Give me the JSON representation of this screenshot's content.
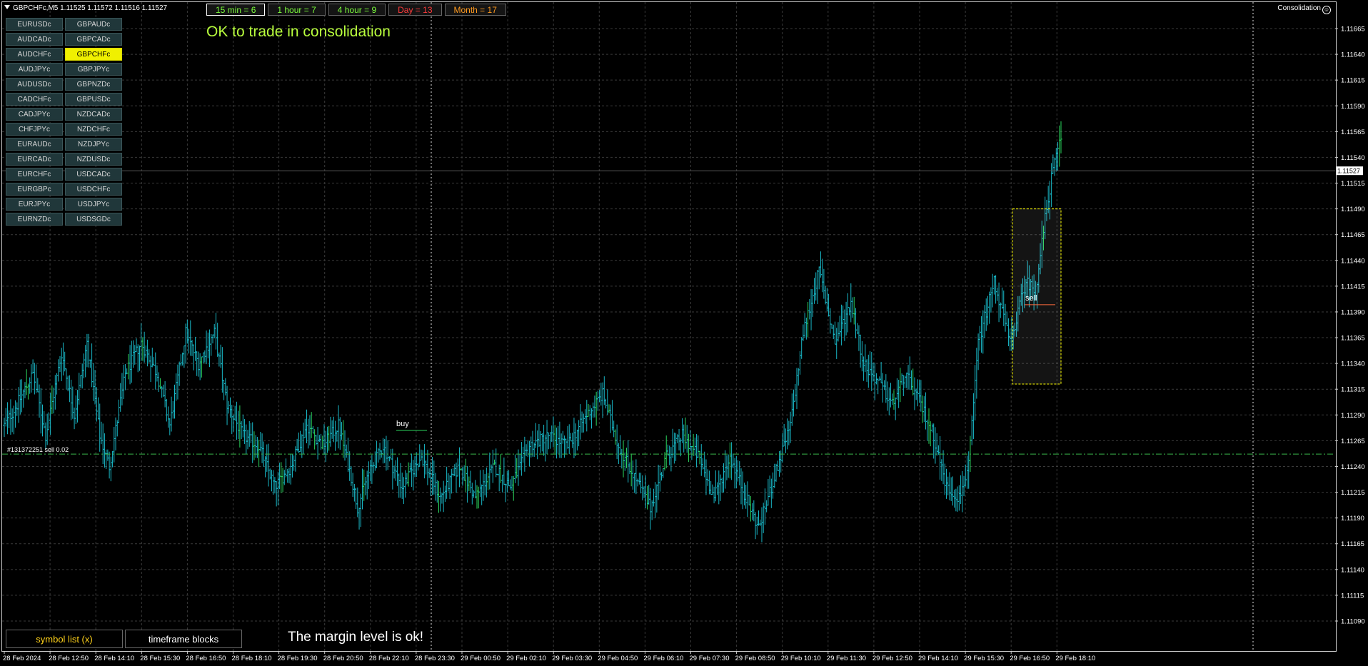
{
  "window": {
    "title": "GBPCHFc,M5  1.11525 1.11572 1.11516 1.11527"
  },
  "indicator": {
    "label": "Consolidation",
    "icon": "smiley-icon"
  },
  "timeframe_blocks": [
    {
      "label": "15 min = 6",
      "color": "#7cff3c",
      "border": "#ffffff"
    },
    {
      "label": "1 hour = 7",
      "color": "#7cff3c",
      "border": "#666666"
    },
    {
      "label": "4 hour = 9",
      "color": "#7cff3c",
      "border": "#666666"
    },
    {
      "label": "Day = 13",
      "color": "#ff3b3b",
      "border": "#666666"
    },
    {
      "label": "Month = 17",
      "color": "#ff9a1f",
      "border": "#666666"
    }
  ],
  "symbols": {
    "col1": [
      "EURUSDc",
      "AUDCADc",
      "AUDCHFc",
      "AUDJPYc",
      "AUDUSDc",
      "CADCHFc",
      "CADJPYc",
      "CHFJPYc",
      "EURAUDc",
      "EURCADc",
      "EURCHFc",
      "EURGBPc",
      "EURJPYc",
      "EURNZDc"
    ],
    "col2": [
      "GBPAUDc",
      "GBPCADc",
      "GBPCHFc",
      "GBPJPYc",
      "GBPNZDc",
      "GBPUSDc",
      "NZDCADc",
      "NZDCHFc",
      "NZDJPYc",
      "NZDUSDc",
      "USDCADc",
      "USDCHFc",
      "USDJPYc",
      "USDSGDc"
    ],
    "active": "GBPCHFc"
  },
  "messages": {
    "consolidation": "OK to trade in consolidation",
    "margin": "The margin level is ok!"
  },
  "buttons": {
    "symbol_list": "symbol list (x)",
    "timeframe_blocks": "timeframe blocks"
  },
  "order_line": {
    "label": "#131372251 sell 0.02",
    "price": 1.11252
  },
  "trade_markers": {
    "buy": "buy",
    "sell": "sell"
  },
  "colors": {
    "candle": "#19b7c6",
    "candle_bull": "#2ad35c",
    "grid": "#3a3a3a",
    "order_line": "#39b54a",
    "consolidation_box": "#ffff00",
    "accent_yellow": "#f0f000"
  },
  "chart_data": {
    "type": "ohlc",
    "symbol": "GBPCHFc",
    "timeframe": "M5",
    "current_price": "1.11527",
    "ylim": [
      1.1107,
      1.1168
    ],
    "y_ticks": [
      "1.11665",
      "1.11640",
      "1.11615",
      "1.11590",
      "1.11565",
      "1.11540",
      "1.11515",
      "1.11490",
      "1.11465",
      "1.11440",
      "1.11415",
      "1.11390",
      "1.11365",
      "1.11340",
      "1.11315",
      "1.11290",
      "1.11265",
      "1.11240",
      "1.11215",
      "1.11190",
      "1.11165",
      "1.11140",
      "1.11115",
      "1.11090"
    ],
    "x_ticks": [
      "28 Feb 2024",
      "28 Feb 12:50",
      "28 Feb 14:10",
      "28 Feb 15:30",
      "28 Feb 16:50",
      "28 Feb 18:10",
      "28 Feb 19:30",
      "28 Feb 20:50",
      "28 Feb 22:10",
      "28 Feb 23:30",
      "29 Feb 00:50",
      "29 Feb 02:10",
      "29 Feb 03:30",
      "29 Feb 04:50",
      "29 Feb 06:10",
      "29 Feb 07:30",
      "29 Feb 08:50",
      "29 Feb 10:10",
      "29 Feb 11:30",
      "29 Feb 12:50",
      "29 Feb 14:10",
      "29 Feb 15:30",
      "29 Feb 16:50",
      "29 Feb 18:10"
    ],
    "consolidation_range": [
      1.1132,
      1.1149
    ],
    "anchors": [
      [
        0,
        1.1128
      ],
      [
        8,
        1.113
      ],
      [
        18,
        1.1133
      ],
      [
        26,
        1.1127
      ],
      [
        36,
        1.1135
      ],
      [
        44,
        1.1129
      ],
      [
        52,
        1.1136
      ],
      [
        60,
        1.1127
      ],
      [
        66,
        1.1124
      ],
      [
        76,
        1.1133
      ],
      [
        86,
        1.1136
      ],
      [
        96,
        1.1133
      ],
      [
        104,
        1.1128
      ],
      [
        114,
        1.1137
      ],
      [
        122,
        1.1134
      ],
      [
        132,
        1.1137
      ],
      [
        140,
        1.113
      ],
      [
        150,
        1.1127
      ],
      [
        160,
        1.1126
      ],
      [
        170,
        1.1122
      ],
      [
        180,
        1.1124
      ],
      [
        190,
        1.1128
      ],
      [
        200,
        1.1126
      ],
      [
        210,
        1.1128
      ],
      [
        218,
        1.1123
      ],
      [
        222,
        1.112
      ],
      [
        228,
        1.1123
      ],
      [
        238,
        1.1126
      ],
      [
        250,
        1.1122
      ],
      [
        262,
        1.1125
      ],
      [
        274,
        1.1121
      ],
      [
        286,
        1.1124
      ],
      [
        296,
        1.1121
      ],
      [
        308,
        1.1124
      ],
      [
        318,
        1.1122
      ],
      [
        330,
        1.1126
      ],
      [
        342,
        1.1127
      ],
      [
        354,
        1.1126
      ],
      [
        366,
        1.1129
      ],
      [
        376,
        1.1131
      ],
      [
        386,
        1.1126
      ],
      [
        396,
        1.1123
      ],
      [
        406,
        1.112
      ],
      [
        416,
        1.1125
      ],
      [
        426,
        1.1127
      ],
      [
        436,
        1.1125
      ],
      [
        446,
        1.1121
      ],
      [
        456,
        1.1125
      ],
      [
        466,
        1.1121
      ],
      [
        474,
        1.1118
      ],
      [
        486,
        1.1124
      ],
      [
        494,
        1.1128
      ],
      [
        502,
        1.1137
      ],
      [
        512,
        1.1143
      ],
      [
        522,
        1.1136
      ],
      [
        532,
        1.114
      ],
      [
        540,
        1.1134
      ],
      [
        550,
        1.1132
      ],
      [
        558,
        1.113
      ],
      [
        566,
        1.1133
      ],
      [
        576,
        1.113
      ],
      [
        584,
        1.1127
      ],
      [
        592,
        1.1122
      ],
      [
        600,
        1.1121
      ],
      [
        606,
        1.1124
      ],
      [
        612,
        1.1136
      ],
      [
        622,
        1.1142
      ],
      [
        632,
        1.1136
      ],
      [
        642,
        1.1142
      ],
      [
        648,
        1.1141
      ],
      [
        654,
        1.1148
      ],
      [
        658,
        1.1152
      ],
      [
        664,
        1.1156
      ]
    ]
  }
}
